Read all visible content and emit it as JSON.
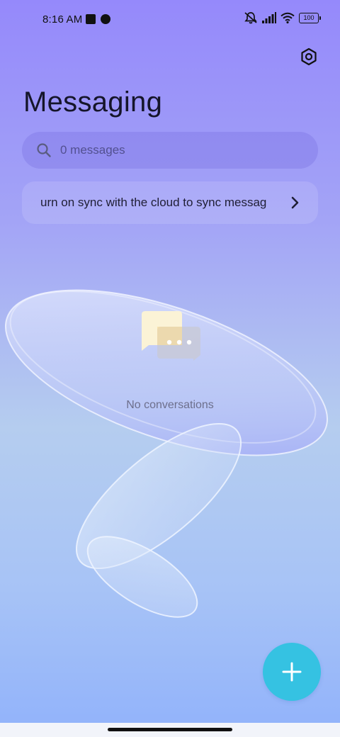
{
  "status_bar": {
    "time": "8:16 AM",
    "battery": "100",
    "icons": [
      "notification-square-icon",
      "app-notification-icon",
      "mute-icon",
      "signal-icon",
      "wifi-icon",
      "battery-icon"
    ]
  },
  "header": {
    "title": "Messaging",
    "settings_icon": "settings-icon"
  },
  "search": {
    "placeholder": "0 messages",
    "icon": "search-icon"
  },
  "sync_banner": {
    "text": "urn on sync with the cloud to sync messag",
    "icon": "chevron-right-icon"
  },
  "empty_state": {
    "icon": "chat-bubbles-icon",
    "text": "No conversations"
  },
  "fab": {
    "icon": "plus-icon",
    "color": "#35c2e2"
  },
  "colors": {
    "background_top": "#9589fb",
    "background_bottom": "#91b2fb"
  }
}
